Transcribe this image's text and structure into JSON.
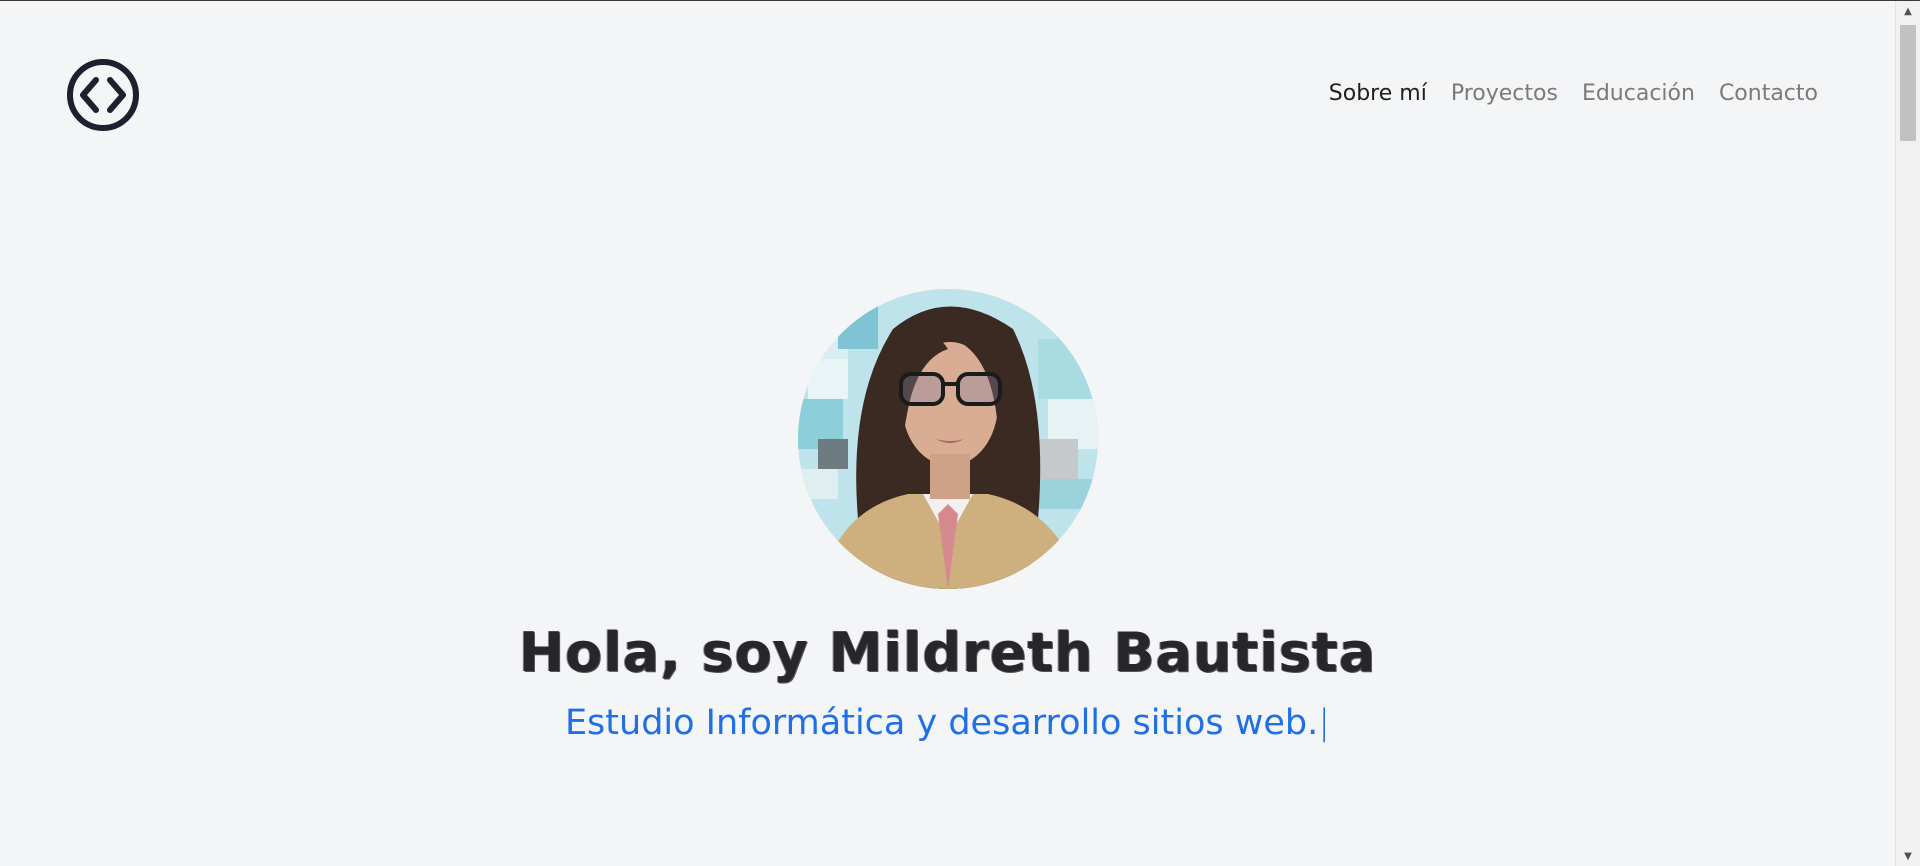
{
  "nav": {
    "logo_icon": "code-brackets-icon",
    "items": [
      {
        "label": "Sobre mí",
        "active": true
      },
      {
        "label": "Proyectos",
        "active": false
      },
      {
        "label": "Educación",
        "active": false
      },
      {
        "label": "Contacto",
        "active": false
      }
    ]
  },
  "hero": {
    "avatar_icon": "profile-photo",
    "title": "Hola, soy Mildreth Bautista",
    "subtitle": "Estudio Informática y desarrollo sitios web.",
    "cursor": "|"
  },
  "colors": {
    "background": "#f4f5f7",
    "accent": "#1f6fe5",
    "nav_active": "#1f1f1f",
    "nav_inactive": "#7a7a7a",
    "title": "#26262c"
  },
  "scrollbar": {
    "up_icon": "scroll-up-arrow-icon",
    "down_icon": "scroll-down-arrow-icon"
  }
}
